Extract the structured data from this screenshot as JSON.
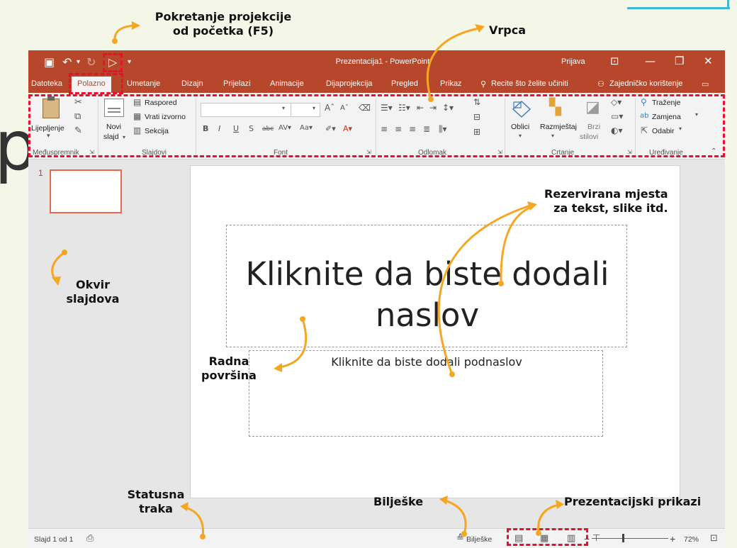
{
  "window": {
    "title": "Prezentacija1 - PowerPoint",
    "sign_in": "Prijava"
  },
  "tabs": [
    "Datoteka",
    "Polazno",
    "Umetanje",
    "Dizajn",
    "Prijelazi",
    "Animacije",
    "Dijaprojekcija",
    "Pregled",
    "Prikaz"
  ],
  "tell_me": "Recite što želite učiniti",
  "share": "Zajedničko korištenje",
  "ribbon": {
    "paste": "Lijepljenje",
    "new_slide_1": "Novi",
    "new_slide_2": "slajd",
    "layout": "Raspored",
    "reset": "Vrati izvorno",
    "section": "Sekcija",
    "shapes": "Oblici",
    "arrange": "Razmještaj",
    "quick_styles_1": "Brzi",
    "quick_styles_2": "stilovi",
    "find": "Traženje",
    "replace": "Zamjena",
    "select": "Odabir",
    "groups": {
      "clipboard": "Međuspremnik",
      "slides": "Slajdovi",
      "font": "Font",
      "paragraph": "Odlomak",
      "drawing": "Crtanje",
      "editing": "Uređivanje"
    }
  },
  "thumbnails": {
    "number": "1"
  },
  "slide": {
    "title_line1": "Kliknite da biste dodali",
    "title_line2": "naslov",
    "subtitle": "Kliknite da biste dodali podnaslov"
  },
  "status": {
    "slide_count": "Slajd 1 od 1",
    "notes": "Bilješke",
    "zoom": "72%"
  },
  "callouts": {
    "slideshow_line1": "Pokretanje projekcije",
    "slideshow_line2": "od početka (F5)",
    "ribbon": "Vrpca",
    "placeholders_line1": "Rezervirana mjesta",
    "placeholders_line2": "za tekst, slike itd.",
    "slides_pane_line1": "Okvir",
    "slides_pane_line2": "slajdova",
    "workspace_line1": "Radna",
    "workspace_line2": "površina",
    "statusbar_line1": "Statusna",
    "statusbar_line2": "traka",
    "notes": "Bilješke",
    "views": "Prezentacijski prikazi"
  },
  "colors": {
    "title_bar": "#b7472a",
    "annotation_arrow": "#f5a623",
    "highlight_dashes": "#e8112d"
  }
}
